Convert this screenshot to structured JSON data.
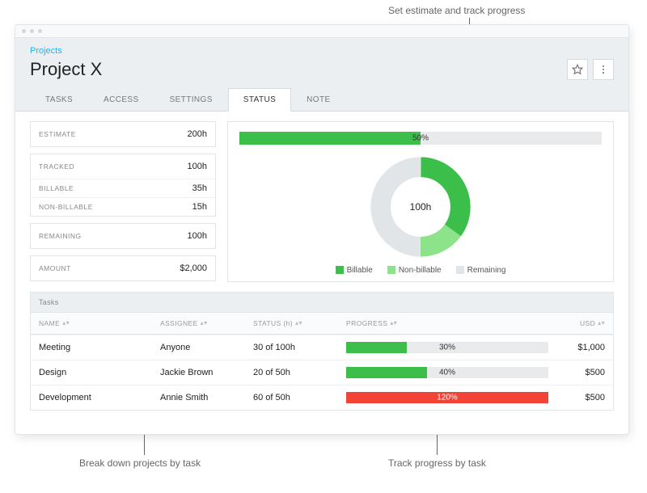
{
  "annotations": {
    "top": "Set estimate and track progress",
    "bottom_left": "Break down projects by task",
    "bottom_right": "Track progress by task"
  },
  "breadcrumb": "Projects",
  "title": "Project X",
  "tabs": {
    "t0": "TASKS",
    "t1": "ACCESS",
    "t2": "SETTINGS",
    "t3": "STATUS",
    "t4": "NOTE"
  },
  "stats": {
    "estimate_label": "ESTIMATE",
    "estimate_val": "200h",
    "tracked_label": "TRACKED",
    "tracked_val": "100h",
    "billable_label": "BILLABLE",
    "billable_val": "35h",
    "nonbillable_label": "NON-BILLABLE",
    "nonbillable_val": "15h",
    "remaining_label": "REMAINING",
    "remaining_val": "100h",
    "amount_label": "AMOUNT",
    "amount_val": "$2,000"
  },
  "chart_data": {
    "progress": {
      "type": "bar",
      "pct": 50,
      "label": "50%"
    },
    "donut": {
      "type": "pie",
      "center_label": "100h",
      "series": [
        {
          "name": "Billable",
          "value": 35,
          "color": "#3bbf4a"
        },
        {
          "name": "Non-billable",
          "value": 15,
          "color": "#8de38a"
        },
        {
          "name": "Remaining",
          "value": 50,
          "color": "#e2e5e8"
        }
      ]
    }
  },
  "legend": {
    "billable": "Billable",
    "nonbillable": "Non-billable",
    "remaining": "Remaining"
  },
  "tasks": {
    "heading": "Tasks",
    "columns": {
      "name": "NAME",
      "assignee": "ASSIGNEE",
      "status": "STATUS (h)",
      "progress": "PROGRESS",
      "usd": "USD"
    },
    "rows": [
      {
        "name": "Meeting",
        "assignee": "Anyone",
        "status": "30 of 100h",
        "pct": 30,
        "pct_label": "30%",
        "color": "#3bbf4a",
        "usd": "$1,000"
      },
      {
        "name": "Design",
        "assignee": "Jackie Brown",
        "status": "20 of 50h",
        "pct": 40,
        "pct_label": "40%",
        "color": "#3bbf4a",
        "usd": "$500"
      },
      {
        "name": "Development",
        "assignee": "Annie Smith",
        "status": "60 of 50h",
        "pct": 120,
        "pct_label": "120%",
        "color": "#f34336",
        "usd": "$500"
      }
    ]
  },
  "colors": {
    "green": "#3bbf4a",
    "lightgreen": "#8de38a",
    "grey": "#e2e5e8",
    "red": "#f34336"
  }
}
